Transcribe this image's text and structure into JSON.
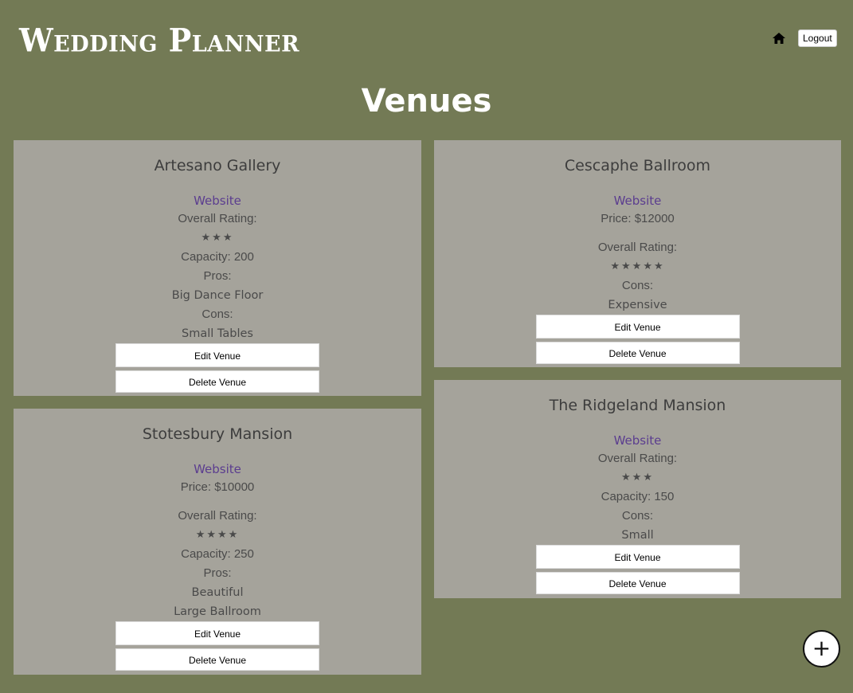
{
  "header": {
    "brand": "Wedding Planner",
    "home_icon": "home-icon",
    "logout_label": "Logout"
  },
  "page_title": "Venues",
  "venues": [
    {
      "name": "Artesano Gallery",
      "website_label": "Website",
      "rating_label": "Overall Rating:",
      "stars": "★★★",
      "capacity": "Capacity: 200",
      "pros_label": "Pros:",
      "pros": "Big Dance Floor",
      "cons_label": "Cons:",
      "cons": "Small Tables",
      "edit_label": "Edit Venue",
      "delete_label": "Delete Venue"
    },
    {
      "name": "Cescaphe Ballroom",
      "website_label": "Website",
      "price": "Price: $12000",
      "rating_label": "Overall Rating:",
      "stars": "★★★★★",
      "cons_label": "Cons:",
      "cons": "Expensive",
      "edit_label": "Edit Venue",
      "delete_label": "Delete Venue"
    },
    {
      "name": "Stotesbury Mansion",
      "website_label": "Website",
      "price": "Price: $10000",
      "rating_label": "Overall Rating:",
      "stars": "★★★★",
      "capacity": "Capacity: 250",
      "pros_label": "Pros:",
      "pros": "Beautiful",
      "pros2": "Large Ballroom",
      "edit_label": "Edit Venue",
      "delete_label": "Delete Venue"
    },
    {
      "name": "The Ridgeland Mansion",
      "website_label": "Website",
      "rating_label": "Overall Rating:",
      "stars": "★★★",
      "capacity": "Capacity: 150",
      "cons_label": "Cons:",
      "cons": "Small",
      "edit_label": "Edit Venue",
      "delete_label": "Delete Venue"
    }
  ],
  "add_button": "+"
}
